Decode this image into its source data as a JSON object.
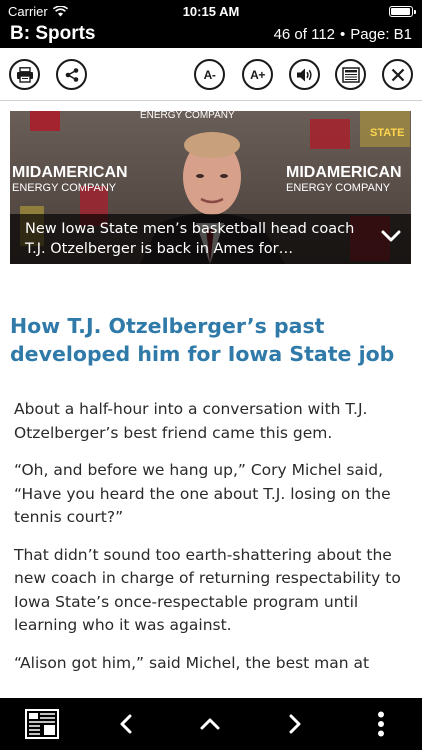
{
  "status_bar": {
    "carrier": "Carrier",
    "time": "10:15 AM"
  },
  "header": {
    "section": "B: Sports",
    "page_count": "46 of 112",
    "separator": "•",
    "page_label": "Page: B1"
  },
  "toolbar": {
    "font_decrease": "A-",
    "font_increase": "A+",
    "icons": [
      "print-icon",
      "share-icon",
      "font-decrease-icon",
      "font-increase-icon",
      "speaker-icon",
      "page-view-icon",
      "close-icon"
    ]
  },
  "video": {
    "caption": "New Iowa State men’s basketball head coach T.J. Otzelberger is back in Ames for…",
    "backdrop_text": [
      "MIDAMERICAN",
      "ENERGY COMPANY",
      "ENERGY COMPANY",
      "STATE"
    ]
  },
  "article": {
    "headline": "How T.J. Otzelberger’s past developed him for Iowa State job",
    "paragraphs": [
      "About a half-hour into a conversation with T.J. Otzelberger’s best friend came this gem.",
      "“Oh, and before we hang up,” Cory Michel said, “Have you heard the one about T.J. losing on the tennis court?”",
      "That didn’t sound too earth-shattering about the new coach in charge of returning respectability to Iowa State’s once-respectable program until learning who it was against.",
      "“Alison got him,” said Michel, the best man at"
    ]
  },
  "bottom_bar": {
    "icons": [
      "pages-grid-icon",
      "prev-arrow-icon",
      "up-arrow-icon",
      "next-arrow-icon",
      "more-vertical-icon"
    ]
  },
  "colors": {
    "headline": "#2f7aa8",
    "bars": "#000000",
    "body_text": "#2a2a2a"
  }
}
